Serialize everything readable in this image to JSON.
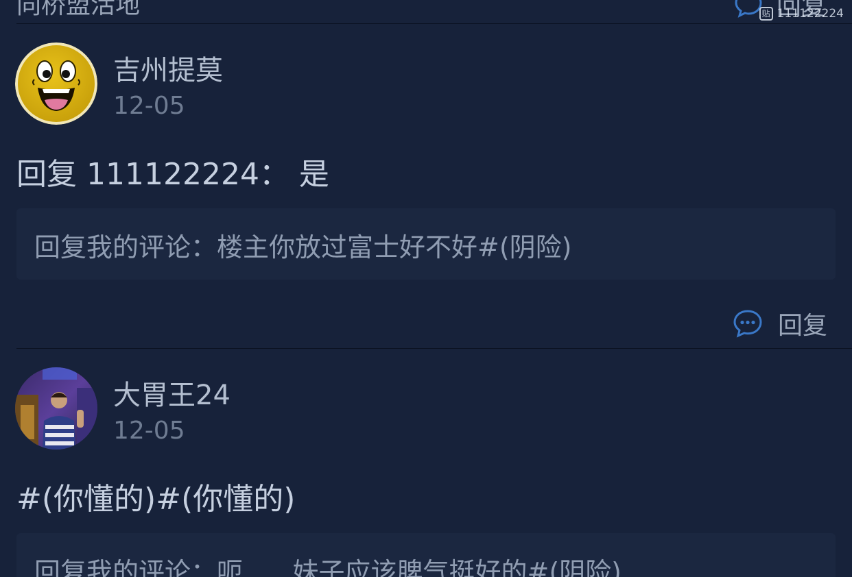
{
  "top_partial": {
    "text": "同桥盟活地",
    "reply_label": "回复"
  },
  "watermark": {
    "logo_char": "贴",
    "text": "111122224"
  },
  "comments": [
    {
      "username": "吉州提莫",
      "date": "12-05",
      "avatar_icon": "smiley-face-avatar",
      "text": "回复 111122224： 是",
      "quote": "回复我的评论：楼主你放过富士好不好#(阴险)",
      "reply_label": "回复"
    },
    {
      "username": "大胃王24",
      "date": "12-05",
      "avatar_icon": "person-photo-avatar",
      "text": "#(你懂的)#(你懂的)",
      "quote": "回复我的评论：呃......妹子应该脾气挺好的#(阴险)"
    }
  ],
  "colors": {
    "background": "#17223a",
    "quote_background": "#1b2740",
    "accent_blue": "#3a78c8",
    "divider": "#0b1222"
  }
}
